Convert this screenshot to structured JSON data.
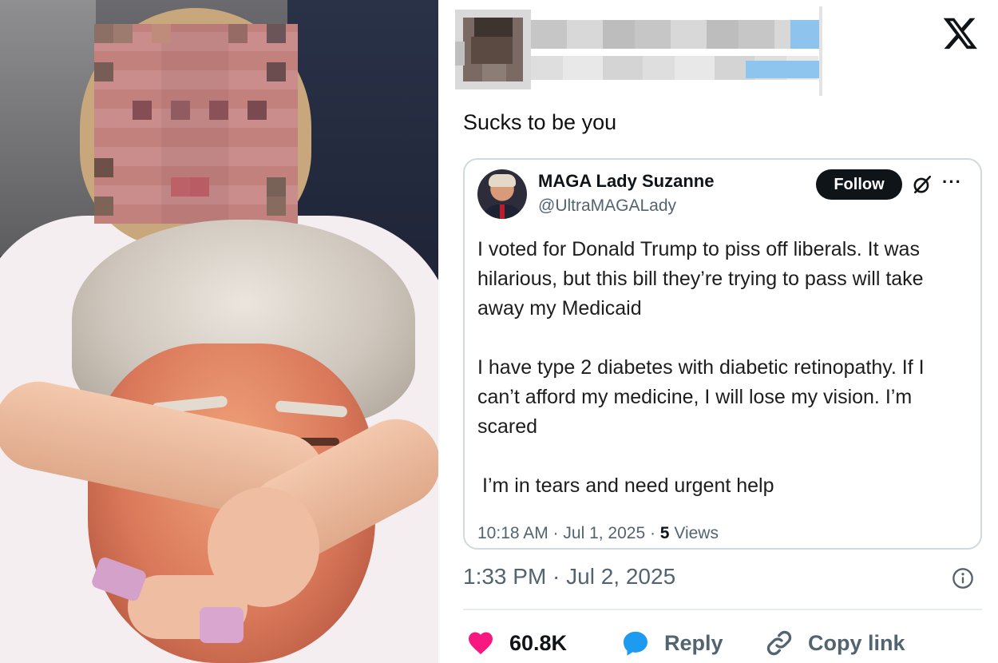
{
  "tweet": {
    "text": "Sucks to be you",
    "timestamp": "1:33 PM · Jul 2, 2025",
    "actions": {
      "like_count": "60.8K",
      "reply_label": "Reply",
      "copy_label": "Copy link"
    }
  },
  "quoted_tweet": {
    "display_name": "MAGA Lady Suzanne",
    "handle": "@UltraMAGALady",
    "follow_label": "Follow",
    "more_label": "···",
    "paragraph_1": "I voted for Donald Trump to piss off liberals. It was hilarious, but this bill they’re trying to pass will take away my Medicaid",
    "paragraph_2": "I have type 2 diabetes with diabetic retinopathy. If I can’t afford my medicine, I will lose my vision. I’m scared",
    "paragraph_3": "I’m in tears and need urgent help",
    "time_date": "10:18 AM · Jul 1, 2025 · ",
    "views_count": "5",
    "views_label": " Views"
  },
  "colors": {
    "like": "#f91880",
    "reply": "#1d9bf0",
    "text_secondary": "#536471",
    "follow_bg": "#0f1419"
  },
  "icons": [
    "x-logo-icon",
    "grok-icon",
    "more-icon",
    "info-icon",
    "heart-icon",
    "reply-bubble-icon",
    "link-icon"
  ]
}
